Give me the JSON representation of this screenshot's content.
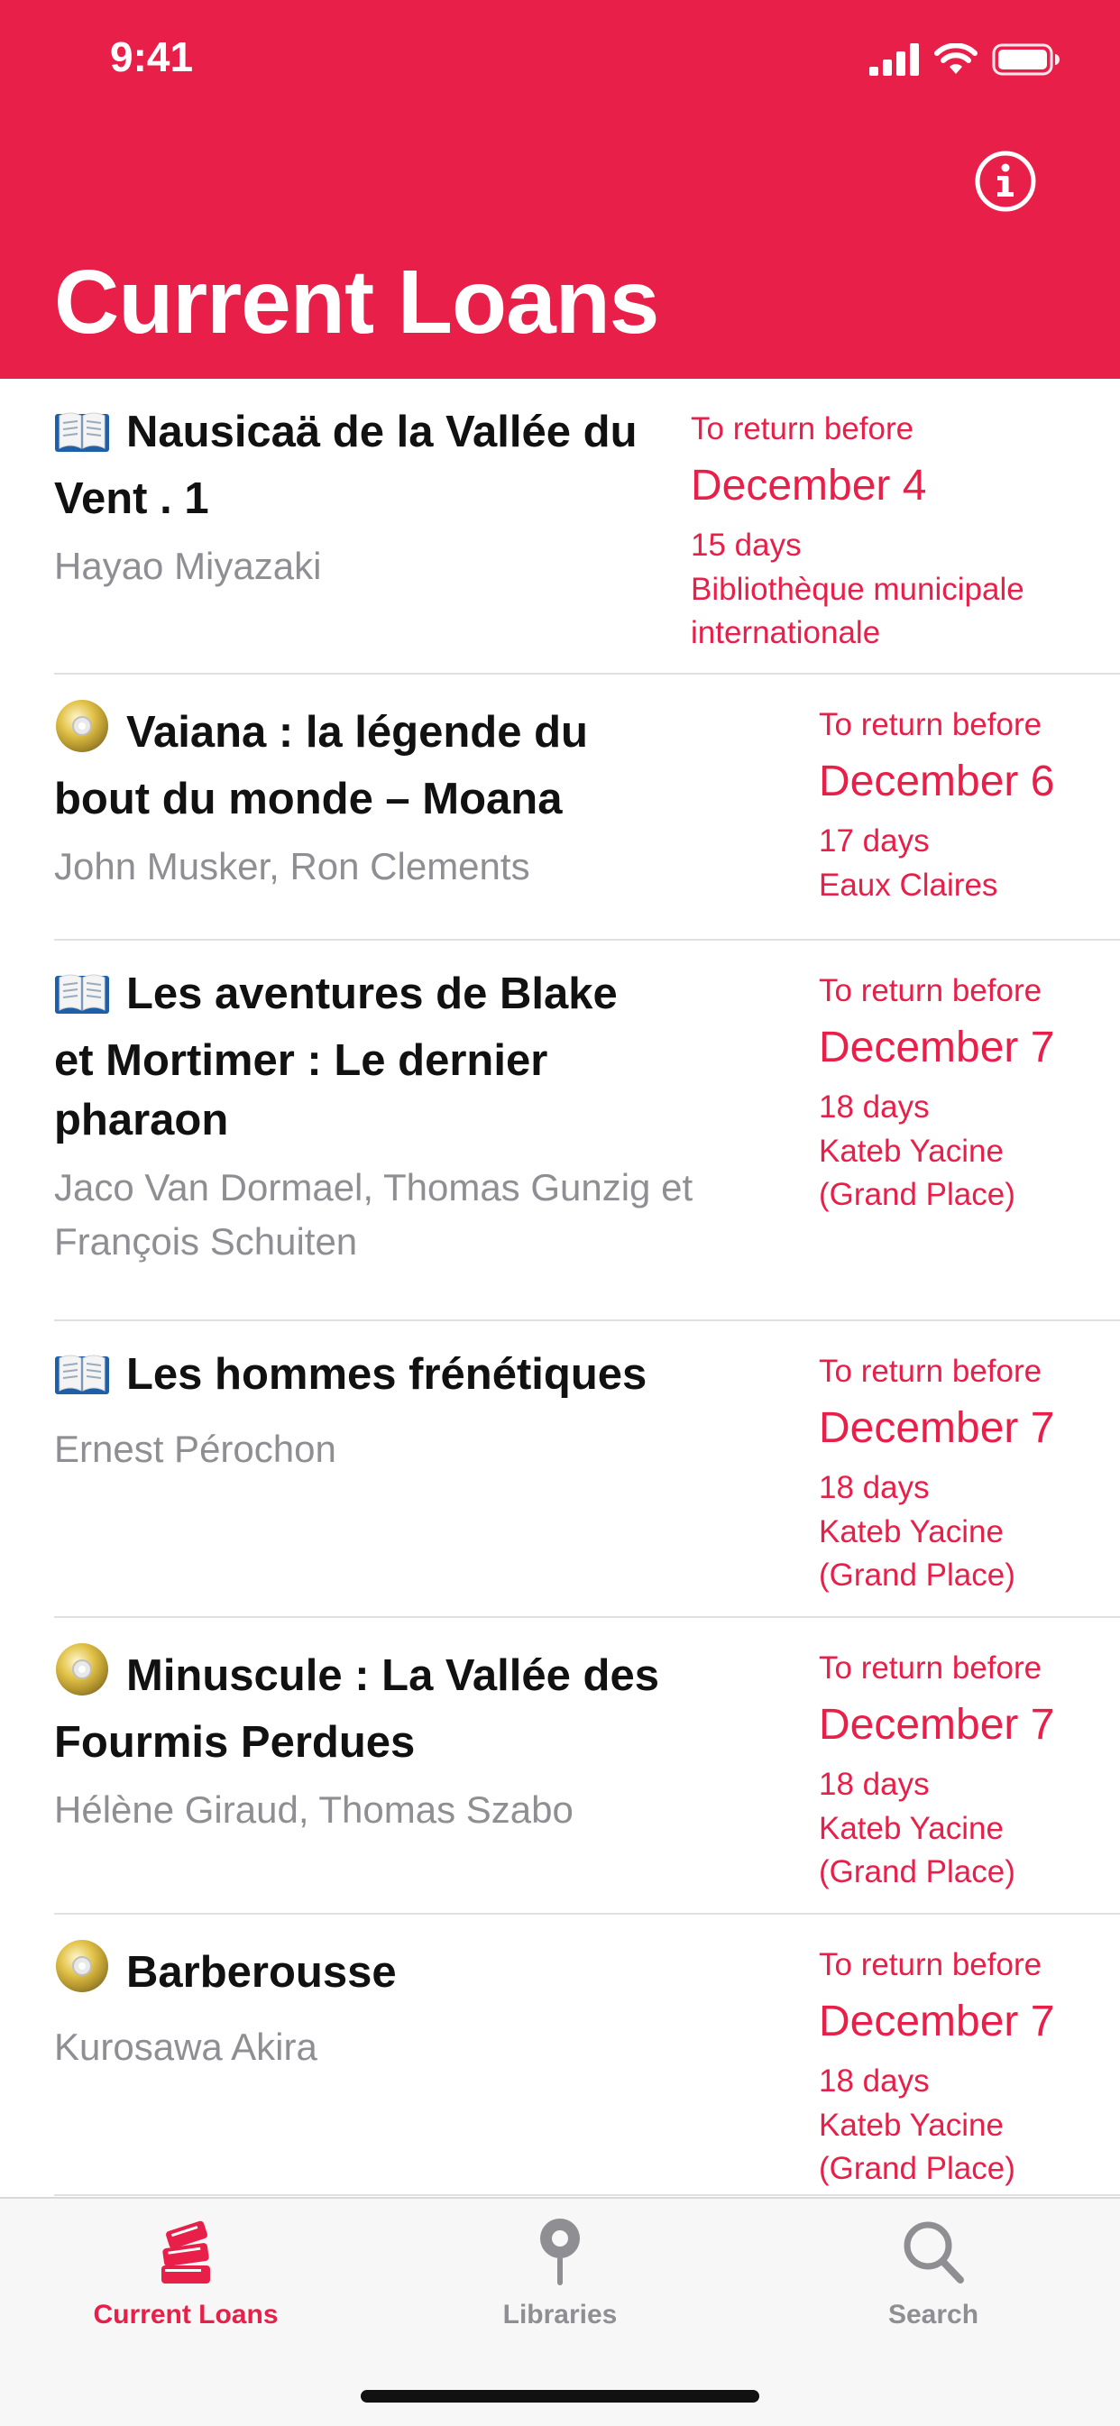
{
  "status_bar": {
    "time": "9:41"
  },
  "header": {
    "title": "Current Loans"
  },
  "loans": [
    {
      "media": "book-icon",
      "title_lines": [
        "Nausicaä de la Vallée du",
        "Vent . 1"
      ],
      "author_lines": [
        "Hayao Miyazaki"
      ],
      "due_label": "To return before",
      "due_date": "December 4",
      "days": "15 days",
      "library_lines": [
        "Bibliothèque municipale",
        "internationale"
      ]
    },
    {
      "media": "disc-icon",
      "title_lines": [
        "Vaiana : la légende du",
        "bout du monde – Moana"
      ],
      "author_lines": [
        "John Musker, Ron Clements"
      ],
      "due_label": "To return before",
      "due_date": "December 6",
      "days": "17 days",
      "library_lines": [
        "Eaux Claires"
      ]
    },
    {
      "media": "book-icon",
      "title_lines": [
        "Les aventures de Blake",
        "et Mortimer : Le dernier",
        "pharaon"
      ],
      "author_lines": [
        "Jaco Van Dormael, Thomas Gunzig et",
        "François Schuiten"
      ],
      "due_label": "To return before",
      "due_date": "December 7",
      "days": "18 days",
      "library_lines": [
        "Kateb Yacine",
        "(Grand Place)"
      ]
    },
    {
      "media": "book-icon",
      "title_lines": [
        "Les hommes frénétiques"
      ],
      "author_lines": [
        "Ernest Pérochon"
      ],
      "due_label": "To return before",
      "due_date": "December 7",
      "days": "18 days",
      "library_lines": [
        "Kateb Yacine",
        "(Grand Place)"
      ]
    },
    {
      "media": "disc-icon",
      "title_lines": [
        "Minuscule : La Vallée des",
        "Fourmis Perdues"
      ],
      "author_lines": [
        "Hélène Giraud, Thomas Szabo"
      ],
      "due_label": "To return before",
      "due_date": "December 7",
      "days": "18 days",
      "library_lines": [
        "Kateb Yacine",
        "(Grand Place)"
      ]
    },
    {
      "media": "disc-icon",
      "title_lines": [
        "Barberousse"
      ],
      "author_lines": [
        "Kurosawa Akira"
      ],
      "due_label": "To return before",
      "due_date": "December 7",
      "days": "18 days",
      "library_lines": [
        "Kateb Yacine",
        "(Grand Place)"
      ]
    }
  ],
  "tabbar": {
    "tabs": [
      {
        "label": "Current Loans",
        "icon": "books-stack-icon",
        "active": true
      },
      {
        "label": "Libraries",
        "icon": "map-pin-icon",
        "active": false
      },
      {
        "label": "Search",
        "icon": "search-icon",
        "active": false
      }
    ]
  },
  "colors": {
    "accent": "#E81F49",
    "secondary_text": "#8e8e93"
  }
}
